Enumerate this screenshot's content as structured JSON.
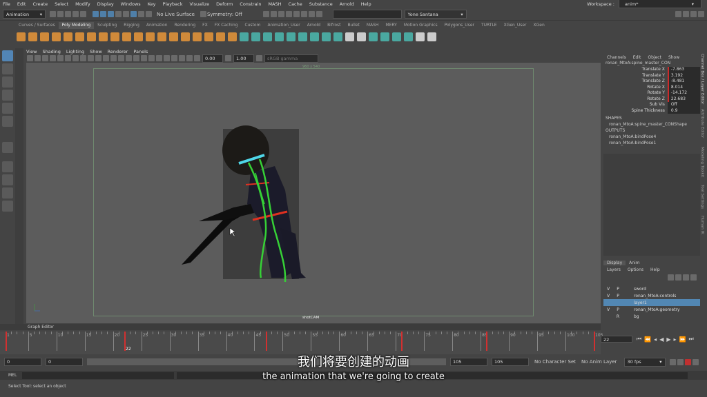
{
  "menubar": {
    "items": [
      "File",
      "Edit",
      "Create",
      "Select",
      "Modify",
      "Display",
      "Windows",
      "Key",
      "Playback",
      "Visualize",
      "Deform",
      "Constrain",
      "MASH",
      "Cache",
      "Substance",
      "Arnold",
      "Help"
    ],
    "workspace_label": "Workspace :",
    "workspace_value": "anim*"
  },
  "statusline": {
    "mode": "Animation",
    "live_surface": "No Live Surface",
    "symmetry": "Symmetry: Off",
    "user": "Yone Santana"
  },
  "shelf": {
    "tabs": [
      "Curves / Surfaces",
      "Poly Modeling",
      "Sculpting",
      "Rigging",
      "Animation",
      "Rendering",
      "FX",
      "FX Caching",
      "Custom",
      "Animation_User",
      "Arnold",
      "Bifrost",
      "Bullet",
      "MASH",
      "MERY",
      "Motion Graphics",
      "Polygons_User",
      "TURTLE",
      "XGen_User",
      "XGen"
    ],
    "active": "Poly Modeling"
  },
  "viewport": {
    "menu": [
      "View",
      "Shading",
      "Lighting",
      "Show",
      "Renderer",
      "Panels"
    ],
    "exposure": "0.00",
    "gamma": "1.00",
    "color_space": "sRGB gamma",
    "camera": "shotCAM",
    "resolution_label": "960 x 540"
  },
  "graph_editor_label": "Graph Editor",
  "timeline": {
    "ticks": [
      "1",
      "5",
      "10",
      "15",
      "20",
      "25",
      "30",
      "35",
      "40",
      "45",
      "50",
      "55",
      "60",
      "65",
      "70",
      "75",
      "80",
      "85",
      "90",
      "95",
      "100",
      "105"
    ],
    "current_frame": "22",
    "current_frame_field": "22"
  },
  "range": {
    "start": "0",
    "anim_start": "0",
    "end": "105",
    "anim_end": "105",
    "char_set": "No Character Set",
    "anim_layer": "No Anim Layer",
    "fps": "30 fps"
  },
  "mel": {
    "label": "MEL"
  },
  "help_line": "Select Tool: select an object",
  "channel_box": {
    "menu": [
      "Channels",
      "Edit",
      "Object",
      "Show"
    ],
    "node": "ronan_MtoA:spine_master_CON",
    "channels": [
      {
        "name": "Translate X",
        "value": "-7.863"
      },
      {
        "name": "Translate Y",
        "value": "3.192"
      },
      {
        "name": "Translate Z",
        "value": "-8.481"
      },
      {
        "name": "Rotate X",
        "value": "8.014"
      },
      {
        "name": "Rotate Y",
        "value": "-14.172"
      },
      {
        "name": "Rotate Z",
        "value": "22.683"
      },
      {
        "name": "Sub Vis",
        "value": "Off"
      },
      {
        "name": "Spine Thickness",
        "value": "0.9"
      }
    ],
    "shapes_header": "SHAPES",
    "shape": "ronan_MtoA:spine_master_CONShape",
    "outputs_header": "OUTPUTS",
    "outputs": [
      "ronan_MtoA:bindPose4",
      "ronan_MtoA:bindPose1"
    ]
  },
  "layer_editor": {
    "tabs": [
      "Display",
      "Anim"
    ],
    "menu": [
      "Layers",
      "Options",
      "Help"
    ],
    "layers": [
      {
        "v": "V",
        "p": "P",
        "name": "sword"
      },
      {
        "v": "V",
        "p": "P",
        "name": "ronan_MtoA:controls"
      },
      {
        "v": "",
        "p": "",
        "name": "layer1"
      },
      {
        "v": "V",
        "p": "P",
        "name": "ronan_MtoA:geometry"
      },
      {
        "v": "",
        "p": "R",
        "name": "bg"
      }
    ]
  },
  "side_tabs": [
    "Channel Box / Layer Editor",
    "Attribute Editor",
    "Modeling Toolkit",
    "Tool Settings",
    "Human IK"
  ],
  "subtitles": {
    "zh": "我们将要创建的动画",
    "en": "the animation that we're going to create"
  },
  "colors": {
    "accent": "#5285b5",
    "key_red": "#d23030",
    "rig_green": "#36d136",
    "rig_cyan": "#4fd6e8",
    "rig_red": "#e03020"
  }
}
